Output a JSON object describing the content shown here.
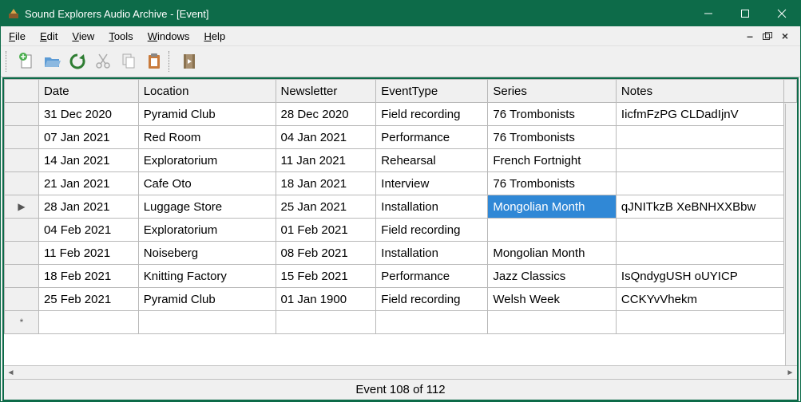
{
  "window": {
    "title": "Sound Explorers Audio Archive - [Event]"
  },
  "menus": {
    "file": "File",
    "edit": "Edit",
    "view": "View",
    "tools": "Tools",
    "windows": "Windows",
    "help": "Help"
  },
  "columns": {
    "date": "Date",
    "location": "Location",
    "newsletter": "Newsletter",
    "eventtype": "EventType",
    "series": "Series",
    "notes": "Notes"
  },
  "rows": [
    {
      "date": "31 Dec 2020",
      "location": "Pyramid Club",
      "newsletter": "28 Dec 2020",
      "eventtype": "Field recording",
      "series": "76 Trombonists",
      "notes": "IicfmFzPG CLDadIjnV"
    },
    {
      "date": "07 Jan 2021",
      "location": "Red Room",
      "newsletter": "04 Jan 2021",
      "eventtype": "Performance",
      "series": "76 Trombonists",
      "notes": ""
    },
    {
      "date": "14 Jan 2021",
      "location": "Exploratorium",
      "newsletter": "11 Jan 2021",
      "eventtype": "Rehearsal",
      "series": "French Fortnight",
      "notes": ""
    },
    {
      "date": "21 Jan 2021",
      "location": "Cafe Oto",
      "newsletter": "18 Jan 2021",
      "eventtype": "Interview",
      "series": "76 Trombonists",
      "notes": ""
    },
    {
      "date": "28 Jan 2021",
      "location": "Luggage Store",
      "newsletter": "25 Jan 2021",
      "eventtype": "Installation",
      "series": "Mongolian Month",
      "notes": "qJNITkzB XeBNHXXBbw"
    },
    {
      "date": "04 Feb 2021",
      "location": "Exploratorium",
      "newsletter": "01 Feb 2021",
      "eventtype": "Field recording",
      "series": "",
      "notes": ""
    },
    {
      "date": "11 Feb 2021",
      "location": "Noiseberg",
      "newsletter": "08 Feb 2021",
      "eventtype": "Installation",
      "series": "Mongolian Month",
      "notes": ""
    },
    {
      "date": "18 Feb 2021",
      "location": "Knitting Factory",
      "newsletter": "15 Feb 2021",
      "eventtype": "Performance",
      "series": "Jazz Classics",
      "notes": "IsQndygUSH oUYICP"
    },
    {
      "date": "25 Feb 2021",
      "location": "Pyramid Club",
      "newsletter": "01 Jan 1900",
      "eventtype": "Field recording",
      "series": "Welsh Week",
      "notes": "CCKYvVhekm"
    }
  ],
  "status": "Event 108 of 112",
  "selected": {
    "row": 4,
    "col": "series"
  },
  "currentRow": 4
}
